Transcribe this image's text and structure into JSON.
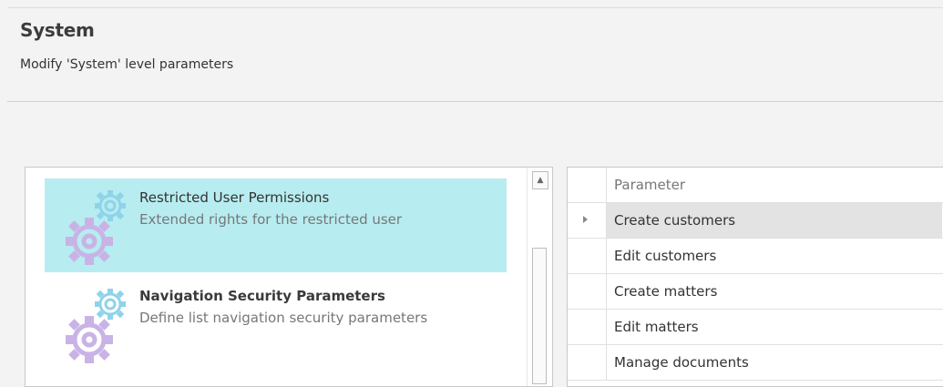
{
  "header": {
    "title": "System",
    "subtitle": "Modify 'System' level parameters"
  },
  "left_panel": {
    "items": [
      {
        "title": "Restricted User Permissions",
        "description": "Extended rights for the restricted user",
        "selected": true,
        "icon": "gears-icon"
      },
      {
        "title": "Navigation Security Parameters",
        "description": "Define list navigation security parameters",
        "selected": false,
        "icon": "gears-icon"
      }
    ],
    "scrollbar": {
      "up_glyph": "▲"
    }
  },
  "grid": {
    "column_header": "Parameter",
    "rows": [
      {
        "label": "Create customers",
        "active": true
      },
      {
        "label": "Edit customers",
        "active": false
      },
      {
        "label": "Create matters",
        "active": false
      },
      {
        "label": "Edit matters",
        "active": false
      },
      {
        "label": "Manage documents",
        "active": false
      }
    ]
  },
  "colors": {
    "selected_item_bg": "#b7ecf0",
    "gear_small": "#8fd3ea",
    "gear_big": "#c9b3e6"
  }
}
